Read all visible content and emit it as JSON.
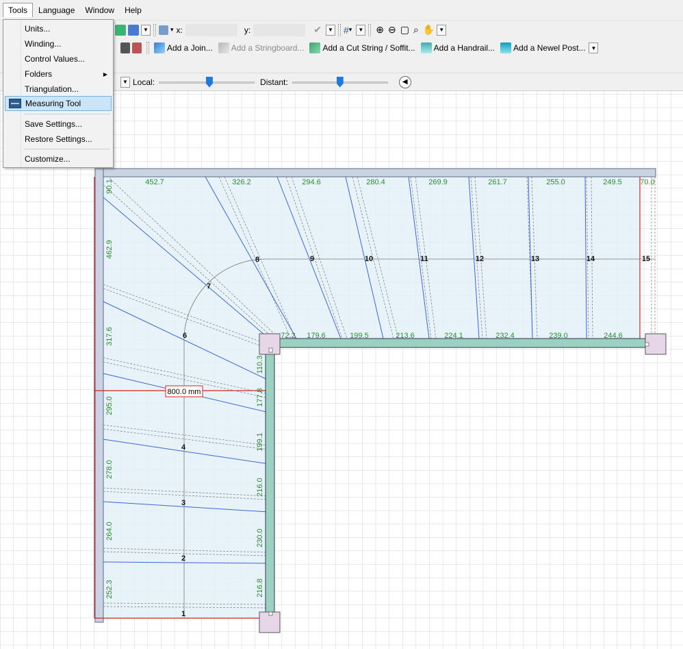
{
  "menubar": {
    "items": [
      "Tools",
      "Language",
      "Window",
      "Help"
    ]
  },
  "tools_menu": {
    "items": [
      "Units...",
      "Winding...",
      "Control Values...",
      "Folders",
      "Triangulation...",
      "Measuring Tool",
      "Save Settings...",
      "Restore Settings...",
      "Customize..."
    ],
    "highlighted": "Measuring Tool"
  },
  "toolbar1": {
    "x_label": "x:",
    "y_label": "y:",
    "x_value": "",
    "y_value": ""
  },
  "toolbar2": {
    "add_join": "Add a Join...",
    "add_stringboard": "Add a Stringboard...",
    "add_cut_string": "Add a Cut String / Soffit...",
    "add_handrail": "Add a Handrail...",
    "add_newel": "Add a Newel Post..."
  },
  "toolbar4": {
    "local_label": "Local:",
    "distant_label": "Distant:",
    "local_level": 0.53,
    "distant_level": 0.5
  },
  "drawing": {
    "tread_numbers": [
      "1",
      "2",
      "3",
      "4",
      "6",
      "7",
      "8",
      "9",
      "10",
      "11",
      "12",
      "13",
      "14",
      "15"
    ],
    "top_measures": [
      "452.7",
      "326.2",
      "294.6",
      "280.4",
      "269.9",
      "261.7",
      "255.0",
      "249.5",
      "70.0"
    ],
    "inner_measures": [
      "72.2",
      "179.6",
      "199.5",
      "213.6",
      "224.1",
      "232.4",
      "239.0",
      "244.6"
    ],
    "left_measures": [
      "90.1",
      "462.9",
      "317.6",
      "295.0",
      "278.0",
      "264.0",
      "252.3"
    ],
    "right_measures": [
      "110.3",
      "177.8",
      "199.1",
      "216.0",
      "230.0",
      "216.8"
    ],
    "measure_label": "800.0 mm"
  },
  "colors": {
    "stair_fill": "#e3f1f8",
    "wall": "#c9d3e4",
    "stringer": "#9ad1c1",
    "red_line": "#d42020",
    "tread_line": "#3b66d6",
    "label_green": "#2e8b2e",
    "grid": "#d2d2d2"
  }
}
